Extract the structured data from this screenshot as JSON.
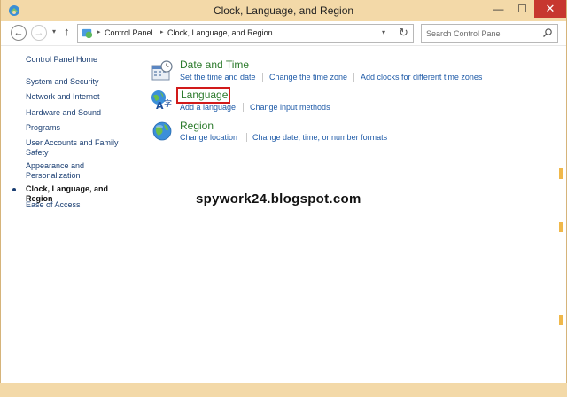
{
  "window": {
    "title": "Clock, Language, and Region"
  },
  "titlebar_buttons": {
    "minimize": "—",
    "maximize": "☐",
    "close": "✕"
  },
  "nav": {
    "back": "←",
    "forward": "→",
    "recent": "▾",
    "up": "↑"
  },
  "address": {
    "crumbs": [
      "Control Panel",
      "Clock, Language, and Region"
    ],
    "separator": "▸",
    "dropdown": "▾",
    "refresh": "↻"
  },
  "search": {
    "placeholder": "Search Control Panel"
  },
  "left_nav": {
    "items": [
      {
        "label": "Control Panel Home"
      },
      {
        "label": "System and Security"
      },
      {
        "label": "Network and Internet"
      },
      {
        "label": "Hardware and Sound"
      },
      {
        "label": "Programs"
      },
      {
        "label": "User Accounts and Family Safety"
      },
      {
        "label": "Appearance and Personalization"
      },
      {
        "label": "Clock, Language, and Region",
        "active": true
      },
      {
        "label": "Ease of Access"
      }
    ]
  },
  "categories": {
    "date_time": {
      "title": "Date and Time",
      "links": [
        "Set the time and date",
        "Change the time zone",
        "Add clocks for different time zones"
      ]
    },
    "language": {
      "title": "Language",
      "links": [
        "Add a language",
        "Change input methods"
      ]
    },
    "region": {
      "title": "Region",
      "links": [
        "Change location",
        "Change date, time, or number formats"
      ]
    }
  },
  "watermark": "spywork24.blogspot.com",
  "colors": {
    "titlebar": "#f3d9a8",
    "category_title": "#2c7a2c",
    "link": "#1f5ba8",
    "highlight_box": "#d11a1a",
    "close_button": "#c7372f"
  },
  "icons": [
    "control-panel-icon",
    "back-icon",
    "forward-icon",
    "up-icon",
    "refresh-icon",
    "search-icon",
    "calendar-clock-icon",
    "language-globe-icon",
    "region-globe-icon"
  ]
}
